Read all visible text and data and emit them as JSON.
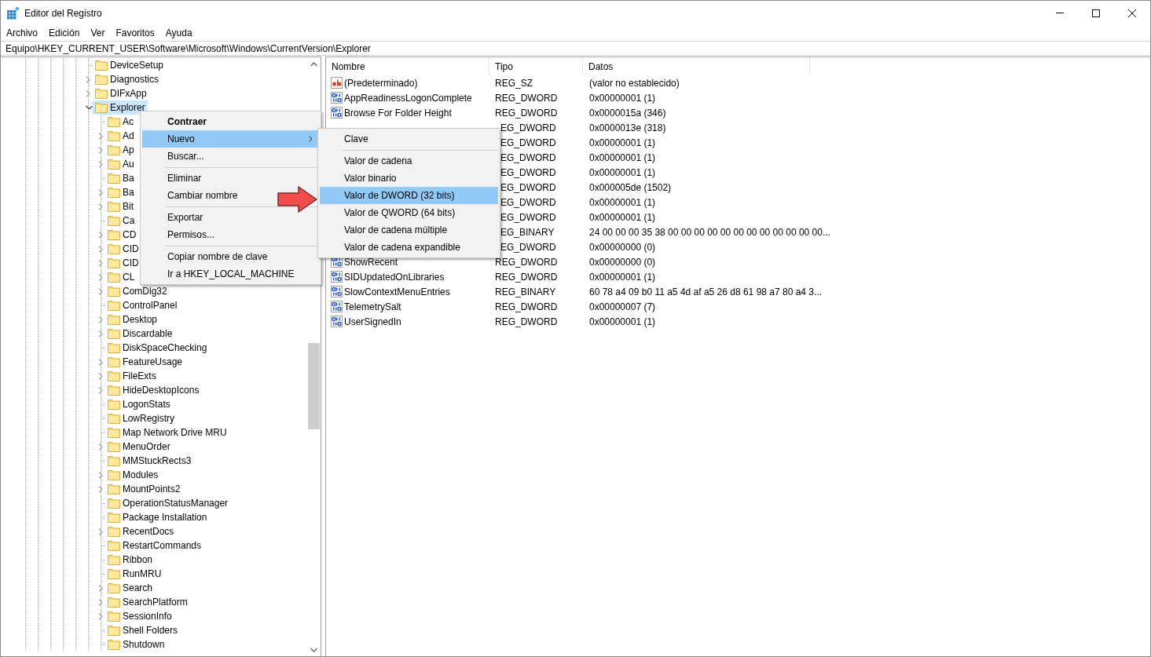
{
  "window": {
    "title": "Editor del Registro"
  },
  "menu_bar": [
    "Archivo",
    "Edición",
    "Ver",
    "Favoritos",
    "Ayuda"
  ],
  "address_bar": {
    "value": "Equipo\\HKEY_CURRENT_USER\\Software\\Microsoft\\Windows\\CurrentVersion\\Explorer"
  },
  "tree": {
    "items": [
      {
        "label": "DeviceSetup",
        "expandable": false,
        "selected": false
      },
      {
        "label": "Diagnostics",
        "expandable": true,
        "expanded": false,
        "selected": false
      },
      {
        "label": "DIFxApp",
        "expandable": true,
        "expanded": false,
        "selected": false
      },
      {
        "label": "Explorer",
        "expandable": true,
        "expanded": true,
        "selected": true,
        "children": [
          {
            "label": "Ac",
            "expandable": false,
            "selected": false
          },
          {
            "label": "Ad",
            "expandable": true,
            "expanded": false,
            "selected": false
          },
          {
            "label": "Ap",
            "expandable": true,
            "expanded": false,
            "selected": false
          },
          {
            "label": "Au",
            "expandable": true,
            "expanded": false,
            "selected": false
          },
          {
            "label": "Ba",
            "expandable": false,
            "selected": false
          },
          {
            "label": "Ba",
            "expandable": true,
            "expanded": false,
            "selected": false
          },
          {
            "label": "Bit",
            "expandable": true,
            "expanded": false,
            "selected": false
          },
          {
            "label": "Ca",
            "expandable": false,
            "selected": false
          },
          {
            "label": "CD",
            "expandable": true,
            "expanded": false,
            "selected": false
          },
          {
            "label": "CID",
            "expandable": true,
            "expanded": false,
            "selected": false
          },
          {
            "label": "CID",
            "expandable": true,
            "expanded": false,
            "selected": false
          },
          {
            "label": "CL",
            "expandable": true,
            "expanded": false,
            "selected": false
          },
          {
            "label": "ComDlg32",
            "expandable": true,
            "expanded": false,
            "selected": false
          },
          {
            "label": "ControlPanel",
            "expandable": false,
            "selected": false
          },
          {
            "label": "Desktop",
            "expandable": true,
            "expanded": false,
            "selected": false
          },
          {
            "label": "Discardable",
            "expandable": true,
            "expanded": false,
            "selected": false
          },
          {
            "label": "DiskSpaceChecking",
            "expandable": false,
            "selected": false
          },
          {
            "label": "FeatureUsage",
            "expandable": true,
            "expanded": false,
            "selected": false
          },
          {
            "label": "FileExts",
            "expandable": true,
            "expanded": false,
            "selected": false
          },
          {
            "label": "HideDesktopIcons",
            "expandable": true,
            "expanded": false,
            "selected": false
          },
          {
            "label": "LogonStats",
            "expandable": false,
            "selected": false
          },
          {
            "label": "LowRegistry",
            "expandable": false,
            "selected": false
          },
          {
            "label": "Map Network Drive MRU",
            "expandable": false,
            "selected": false
          },
          {
            "label": "MenuOrder",
            "expandable": true,
            "expanded": false,
            "selected": false
          },
          {
            "label": "MMStuckRects3",
            "expandable": false,
            "selected": false
          },
          {
            "label": "Modules",
            "expandable": true,
            "expanded": false,
            "selected": false
          },
          {
            "label": "MountPoints2",
            "expandable": true,
            "expanded": false,
            "selected": false
          },
          {
            "label": "OperationStatusManager",
            "expandable": false,
            "selected": false
          },
          {
            "label": "Package Installation",
            "expandable": false,
            "selected": false
          },
          {
            "label": "RecentDocs",
            "expandable": true,
            "expanded": false,
            "selected": false
          },
          {
            "label": "RestartCommands",
            "expandable": false,
            "selected": false
          },
          {
            "label": "Ribbon",
            "expandable": false,
            "selected": false
          },
          {
            "label": "RunMRU",
            "expandable": false,
            "selected": false
          },
          {
            "label": "Search",
            "expandable": true,
            "expanded": false,
            "selected": false
          },
          {
            "label": "SearchPlatform",
            "expandable": true,
            "expanded": false,
            "selected": false
          },
          {
            "label": "SessionInfo",
            "expandable": true,
            "expanded": false,
            "selected": false
          },
          {
            "label": "Shell Folders",
            "expandable": false,
            "selected": false
          },
          {
            "label": "Shutdown",
            "expandable": false,
            "selected": false
          }
        ]
      }
    ]
  },
  "values_table": {
    "columns": [
      "Nombre",
      "Tipo",
      "Datos"
    ],
    "rows": [
      {
        "kind": "string",
        "name": "(Predeterminado)",
        "type": "REG_SZ",
        "data": "(valor no establecido)"
      },
      {
        "kind": "binary",
        "name": "AppReadinessLogonComplete",
        "type": "REG_DWORD",
        "data": "0x00000001 (1)"
      },
      {
        "kind": "binary",
        "name": "Browse For Folder Height",
        "type": "REG_DWORD",
        "data": "0x0000015a (346)"
      },
      {
        "type": "EG_DWORD",
        "data": "0x0000013e (318)"
      },
      {
        "type": "EG_DWORD",
        "data": "0x00000001 (1)"
      },
      {
        "type": "EG_DWORD",
        "data": "0x00000001 (1)"
      },
      {
        "type": "EG_DWORD",
        "data": "0x00000001 (1)"
      },
      {
        "type": "EG_DWORD",
        "data": "0x000005de (1502)"
      },
      {
        "type": "EG_DWORD",
        "data": "0x00000001 (1)"
      },
      {
        "type": "EG_DWORD",
        "data": "0x00000001 (1)"
      },
      {
        "type": "EG_BINARY",
        "data": "24 00 00 00 35 38 00 00 00 00 00 00 00 00 00 00 00 00..."
      },
      {
        "type": "EG_DWORD",
        "data": "0x00000000 (0)"
      },
      {
        "kind": "binary",
        "name": "ShowRecent",
        "type": "REG_DWORD",
        "data": "0x00000000 (0)"
      },
      {
        "kind": "binary",
        "name": "SIDUpdatedOnLibraries",
        "type": "REG_DWORD",
        "data": "0x00000001 (1)"
      },
      {
        "kind": "binary",
        "name": "SlowContextMenuEntries",
        "type": "REG_BINARY",
        "data": "60 78 a4 09 b0 11 a5 4d af a5 26 d8 61 98 a7 80 a4 3..."
      },
      {
        "kind": "binary",
        "name": "TelemetrySalt",
        "type": "REG_DWORD",
        "data": "0x00000007 (7)"
      },
      {
        "kind": "binary",
        "name": "UserSignedIn",
        "type": "REG_DWORD",
        "data": "0x00000001 (1)"
      }
    ]
  },
  "context_menu": {
    "items": [
      {
        "kind": "item",
        "label": "Contraer",
        "bold": true,
        "submenu": false,
        "selected": false
      },
      {
        "kind": "item",
        "label": "Nuevo",
        "bold": false,
        "submenu": true,
        "selected": true
      },
      {
        "kind": "item",
        "label": "Buscar...",
        "bold": false,
        "submenu": false,
        "selected": false
      },
      {
        "kind": "separator"
      },
      {
        "kind": "item",
        "label": "Eliminar",
        "bold": false,
        "submenu": false,
        "selected": false
      },
      {
        "kind": "item",
        "label": "Cambiar nombre",
        "bold": false,
        "submenu": false,
        "selected": false
      },
      {
        "kind": "separator"
      },
      {
        "kind": "item",
        "label": "Exportar",
        "bold": false,
        "submenu": false,
        "selected": false
      },
      {
        "kind": "item",
        "label": "Permisos...",
        "bold": false,
        "submenu": false,
        "selected": false
      },
      {
        "kind": "separator"
      },
      {
        "kind": "item",
        "label": "Copiar nombre de clave",
        "bold": false,
        "submenu": false,
        "selected": false
      },
      {
        "kind": "item",
        "label": "Ir a HKEY_LOCAL_MACHINE",
        "bold": false,
        "submenu": false,
        "selected": false
      }
    ]
  },
  "submenu": {
    "items": [
      {
        "kind": "item",
        "label": "Clave",
        "selected": false
      },
      {
        "kind": "separator"
      },
      {
        "kind": "item",
        "label": "Valor de cadena",
        "selected": false
      },
      {
        "kind": "item",
        "label": "Valor binario",
        "selected": false
      },
      {
        "kind": "item",
        "label": "Valor de DWORD (32 bits)",
        "selected": true
      },
      {
        "kind": "item",
        "label": "Valor de QWORD (64 bits)",
        "selected": false
      },
      {
        "kind": "item",
        "label": "Valor de cadena múltiple",
        "selected": false
      },
      {
        "kind": "item",
        "label": "Valor de cadena expandible",
        "selected": false
      }
    ]
  }
}
